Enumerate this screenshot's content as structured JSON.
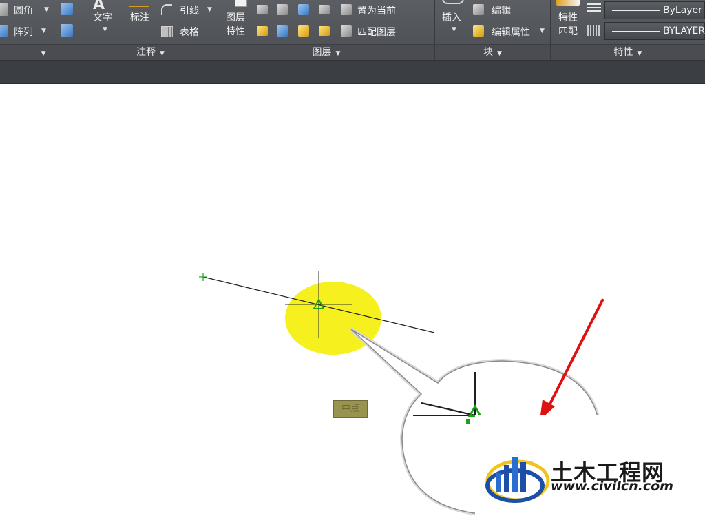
{
  "ribbon": {
    "modify_panel": {
      "fillet_label": "圆角",
      "array_label": "阵列"
    },
    "annotation_panel": {
      "title": "注释",
      "text_label": "文字",
      "dimension_label": "标注",
      "leader_label": "引线",
      "table_label": "表格"
    },
    "layers_panel": {
      "title": "图层",
      "layer_props_label_1": "图层",
      "layer_props_label_2": "特性",
      "set_current_label": "置为当前",
      "match_layer_label": "匹配图层"
    },
    "block_panel": {
      "title": "块",
      "insert_label": "插入",
      "edit_label": "编辑",
      "edit_attributes_label": "编辑属性"
    },
    "properties_panel": {
      "title": "特性",
      "match_props_label_1": "特性",
      "match_props_label_2": "匹配",
      "linetype_value": "ByLayer",
      "lineweight_value": "BYLAYER"
    }
  },
  "canvas": {
    "osnap_tooltip": "中点",
    "snap_marker_color": "#1aa31a",
    "highlight_color": "#f5f01e",
    "arrow_color": "#e01010"
  },
  "watermark": {
    "title": "土木工程网",
    "url": "www.civilcn.com"
  }
}
